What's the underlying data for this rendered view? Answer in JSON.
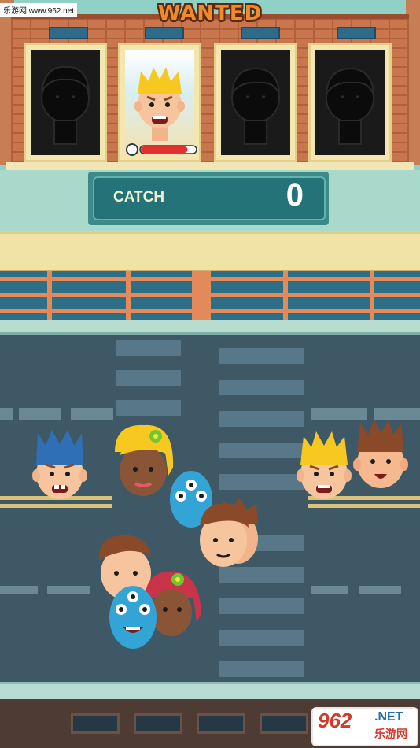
{
  "watermark": {
    "site": "乐游网 www.962.net"
  },
  "header": {
    "title": "WANTED"
  },
  "wanted_slots": [
    {
      "state": "silhouette"
    },
    {
      "state": "revealed",
      "character": "blonde-spiky-hair-man"
    },
    {
      "state": "silhouette"
    },
    {
      "state": "silhouette"
    }
  ],
  "timer": {
    "remaining_fraction": 0.85,
    "color": "#e0302f"
  },
  "catch": {
    "label": "CATCH",
    "value": "0"
  },
  "crowd": [
    "blue-hair-man",
    "blonde-girl-flower",
    "blue-alien",
    "brown-hair-man",
    "brown-hair-man-2",
    "red-hair-girl-flower",
    "blue-alien-2",
    "blonde-spiky-hair-man",
    "brown-spiky-hair-man"
  ],
  "logo": {
    "numbers": "962",
    "suffix": ".NET",
    "chinese": "乐游网"
  },
  "colors": {
    "accent": "#f08a2a",
    "catch_panel": "#247378",
    "road": "#3f5866"
  }
}
